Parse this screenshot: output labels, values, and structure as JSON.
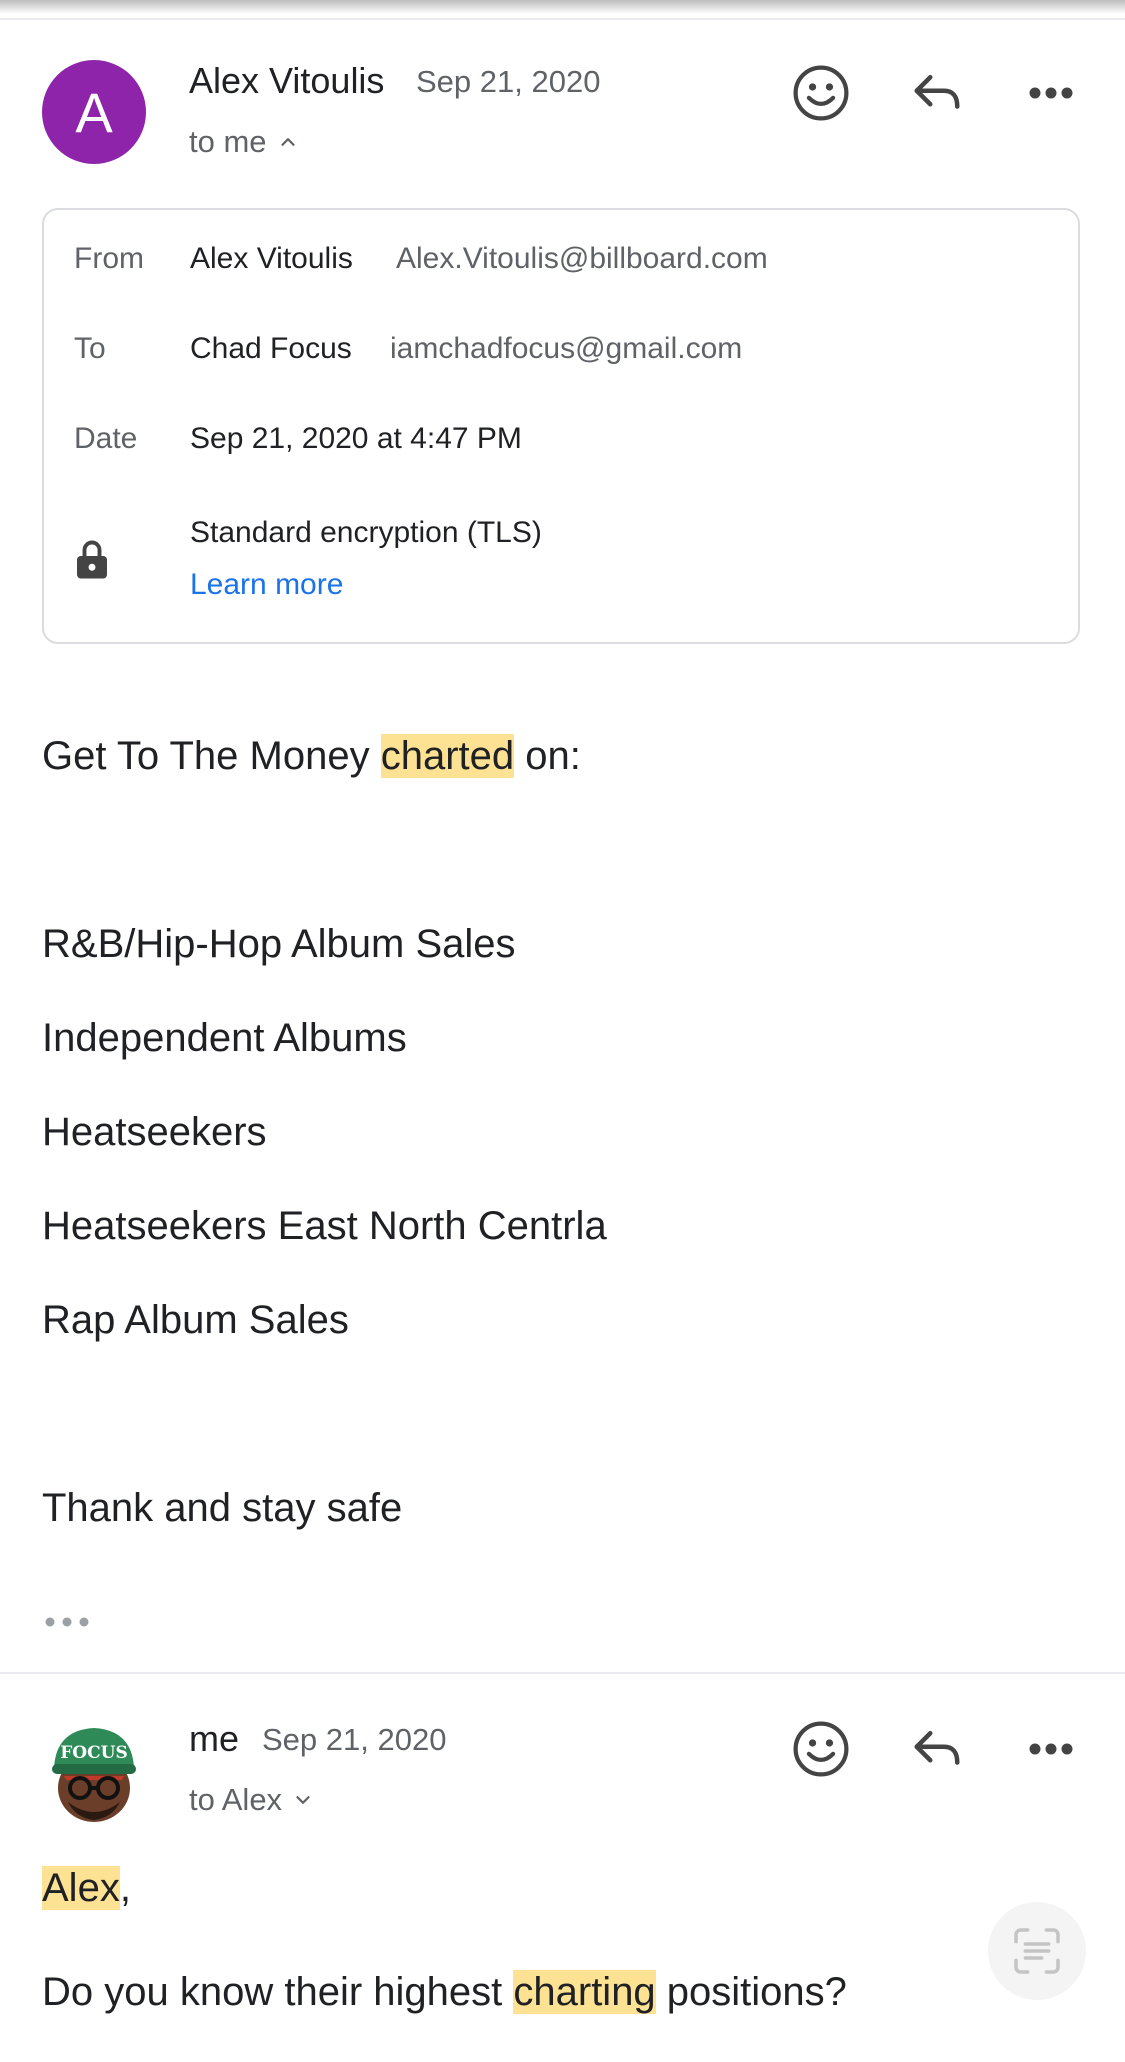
{
  "message1": {
    "avatar_letter": "A",
    "avatar_color": "#8e24aa",
    "sender": "Alex Vitoulis",
    "date": "Sep 21, 2020",
    "to": "to me",
    "details": {
      "from_label": "From",
      "from_name": "Alex Vitoulis",
      "from_email": "Alex.Vitoulis@billboard.com",
      "to_label": "To",
      "to_name": "Chad Focus",
      "to_email": "iamchadfocus@gmail.com",
      "date_label": "Date",
      "date_value": "Sep 21, 2020 at 4:47 PM",
      "encryption": "Standard encryption (TLS)",
      "learn_more": "Learn more"
    },
    "body": {
      "intro_before": "Get To The Money ",
      "intro_highlight": "charted",
      "intro_after": " on:",
      "charts": [
        "R&B/Hip-Hop Album Sales",
        "Independent Albums",
        "Heatseekers",
        "Heatseekers East North Centrla",
        "Rap Album Sales"
      ],
      "closing": "Thank and stay safe"
    }
  },
  "message2": {
    "avatar_text": "FOCUS",
    "sender": "me",
    "date": "Sep 21, 2020",
    "to": "to Alex",
    "greeting_highlight": "Alex",
    "greeting_after": ",",
    "question_before": "Do you know their highest ",
    "question_highlight": "charting",
    "question_after": " positions?"
  },
  "icons": {
    "emoji": "smiley-icon",
    "reply": "reply-icon",
    "more": "more-icon"
  },
  "colors": {
    "highlight": "#fde293",
    "link": "#1a73e8",
    "avatar": "#8e24aa"
  }
}
